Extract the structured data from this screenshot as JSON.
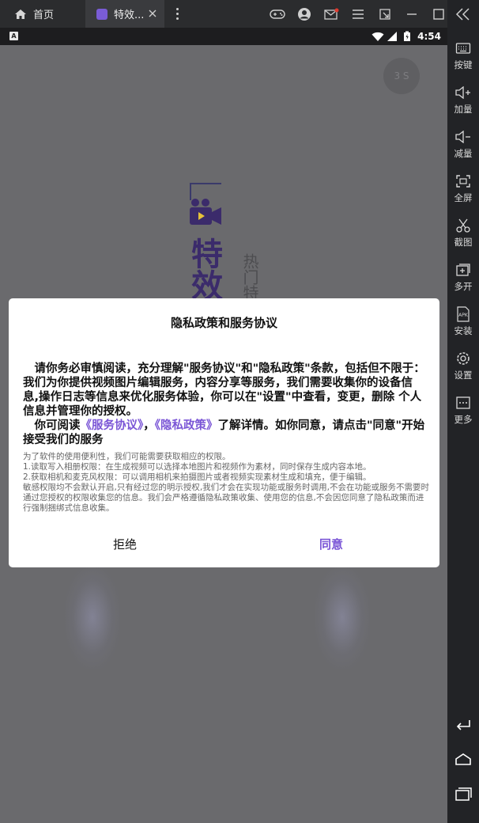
{
  "emulator": {
    "home_tab_label": "首页",
    "active_tab_label": "特效...",
    "sidebar": [
      {
        "label": "按键",
        "icon": "keyboard-icon"
      },
      {
        "label": "加量",
        "icon": "volume-up-icon"
      },
      {
        "label": "减量",
        "icon": "volume-down-icon"
      },
      {
        "label": "全屏",
        "icon": "fullscreen-icon"
      },
      {
        "label": "截图",
        "icon": "scissors-icon"
      },
      {
        "label": "多开",
        "icon": "multi-instance-icon"
      },
      {
        "label": "安装",
        "icon": "apk-install-icon"
      },
      {
        "label": "设置",
        "icon": "gear-icon"
      },
      {
        "label": "更多",
        "icon": "more-icon"
      }
    ],
    "apk_badge": "APK"
  },
  "statusbar": {
    "indicator": "A",
    "time": "4:54"
  },
  "splash": {
    "skip_label": "3 S",
    "big_text": "特效",
    "small_text": "热门特"
  },
  "dialog": {
    "title": "隐私政策和服务协议",
    "para1": "请你务必审慎阅读，充分理解\"服务协议\"和\"隐私政策\"条款，包括但不限于：我们为你提供视频图片编辑服务，内容分享等服务，我们需要收集你的设备信息,操作日志等信息来优化服务体验，你可以在\"设置\"中查看，变更，删除 个人信息并管理你的授权。",
    "para2_prefix": "你可阅读",
    "service_link": "《服务协议》",
    "sep": "，",
    "privacy_link": "《隐私政策》",
    "para2_suffix": "了解详情。如你同意，请点击\"同意\"开始接受我们的服务",
    "small_line1": "为了软件的使用便利性，我们可能需要获取相应的权限。",
    "small_line2": "1.读取写入相册权限：在生成视频可以选择本地图片和视频作为素材，同时保存生成内容本地。",
    "small_line3": "2.获取相机和麦克风权限：可以调用相机来拍摄图片或者视频实现素材生成和填充，便于编辑。",
    "small_line4": "敏感权限均不会默认开启,只有经过您的明示授权,我们才会在实现功能或服务时调用,不会在功能或服务不需要时通过您授权的权限收集您的信息。我们会严格遵循隐私政策收集、使用您的信息,不会因您同意了隐私政策而进行强制捆绑式信息收集。",
    "reject_label": "拒绝",
    "agree_label": "同意"
  },
  "colors": {
    "accent": "#7a55d6",
    "screen_bg": "#6a6a6d",
    "sidebar_bg": "#222326"
  }
}
